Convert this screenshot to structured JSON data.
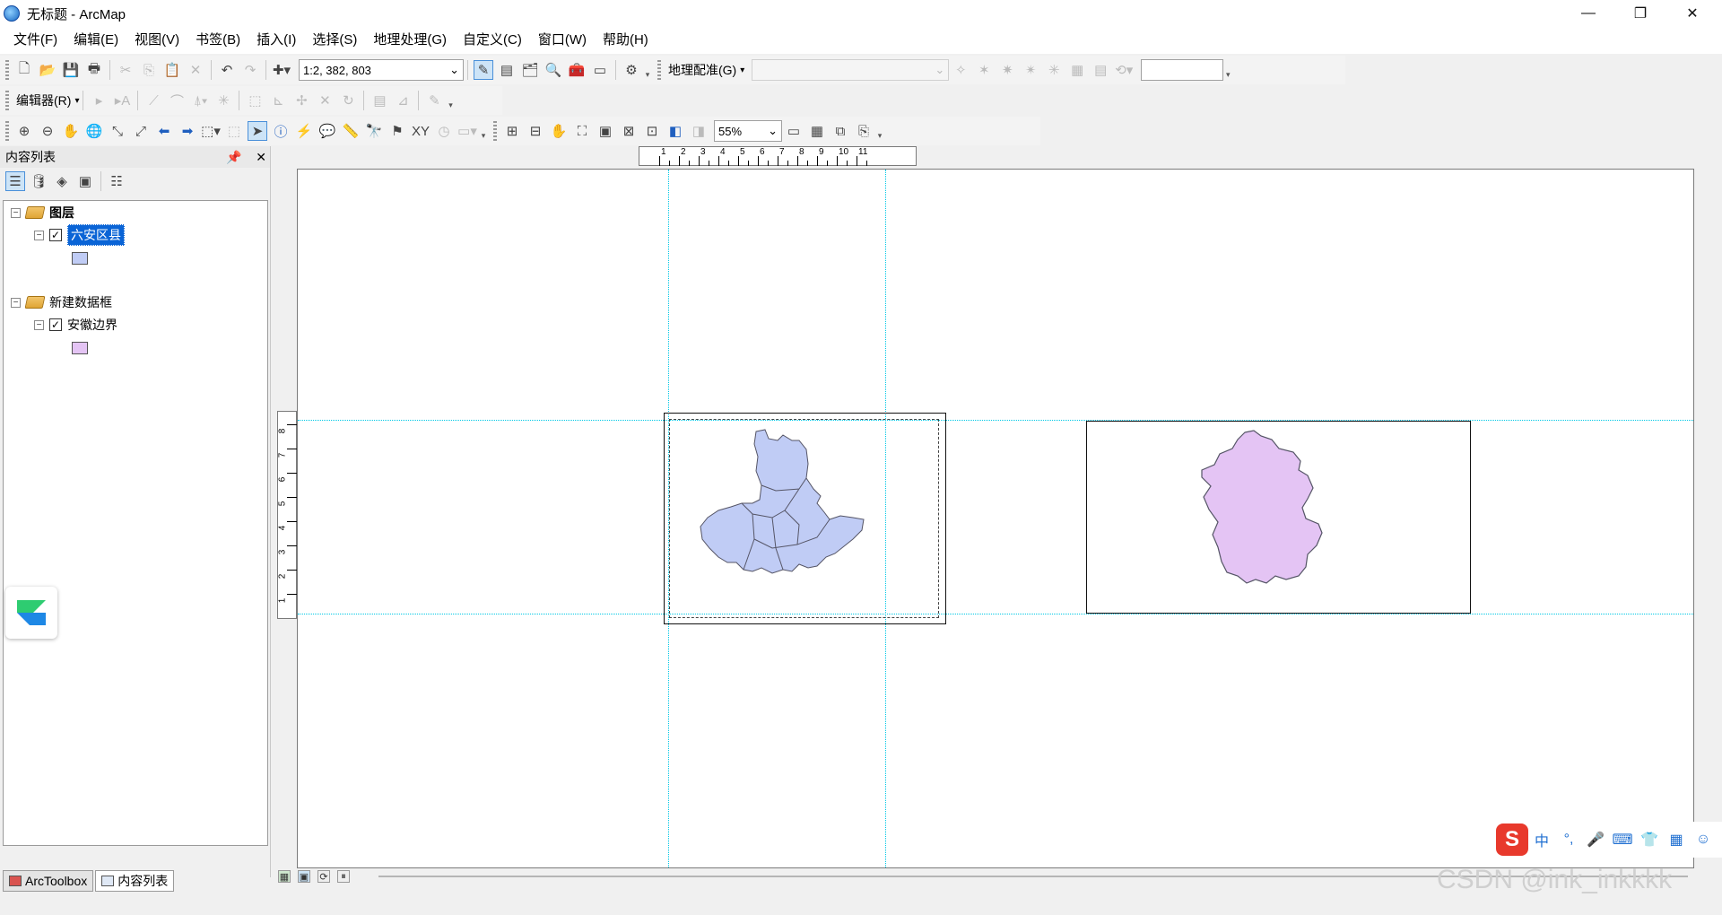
{
  "window": {
    "title": "无标题 - ArcMap",
    "minimize_icon": "minimize-icon",
    "restore_icon": "restore-icon",
    "close_icon": "close-icon"
  },
  "menu": [
    "文件(F)",
    "编辑(E)",
    "视图(V)",
    "书签(B)",
    "插入(I)",
    "选择(S)",
    "地理处理(G)",
    "自定义(C)",
    "窗口(W)",
    "帮助(H)"
  ],
  "standard_toolbar": {
    "scale": "1:2, 382, 803",
    "georef_label": "地理配准(G)",
    "georef_layer": ""
  },
  "editor_toolbar": {
    "editor_label": "编辑器(R)"
  },
  "layout_toolbar": {
    "zoom_percent": "55%"
  },
  "toc": {
    "title": "内容列表",
    "pin_icon": "pin-icon",
    "close_icon": "close-icon",
    "frames": [
      {
        "name": "图层",
        "layer": "六安区县",
        "swatch": "#c0ccf5"
      },
      {
        "name": "新建数据框",
        "layer": "安徽边界",
        "swatch": "#e4c4f4"
      }
    ],
    "tabs": [
      "ArcToolbox",
      "内容列表"
    ]
  },
  "ruler": {
    "horizontal": [
      "1",
      "2",
      "3",
      "4",
      "5",
      "6",
      "7",
      "8",
      "9",
      "10",
      "11"
    ],
    "vertical": [
      "8",
      "7",
      "6",
      "5",
      "4",
      "3",
      "2",
      "1"
    ]
  },
  "map": {
    "liuan_fill": "#c0ccf5",
    "anhui_fill": "#e4c4f4",
    "outline": "#555566",
    "guide_color": "#00c8e6"
  },
  "ime": {
    "logo": "S",
    "items": [
      "中",
      "°,",
      "🎤",
      "⌨",
      "👕",
      "▦",
      "☺"
    ]
  },
  "watermark": "CSDN @ink_inkkkk"
}
